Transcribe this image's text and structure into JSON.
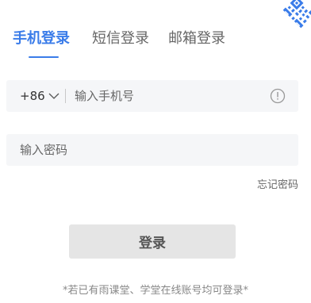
{
  "colors": {
    "accent": "#3a7ce9",
    "qr_blue": "#3a7ce9",
    "field_bg": "#f5f6f8",
    "button_bg": "#e5e5e5"
  },
  "qr_toggle": {
    "icon": "qr-code-icon"
  },
  "tabs": [
    {
      "label": "手机登录",
      "active": true
    },
    {
      "label": "短信登录",
      "active": false
    },
    {
      "label": "邮箱登录",
      "active": false
    }
  ],
  "phone": {
    "country_code": "+86",
    "placeholder": "输入手机号",
    "value": "",
    "info_icon": "info-circle-icon"
  },
  "password": {
    "placeholder": "输入密码",
    "value": ""
  },
  "forgot_label": "忘记密码",
  "login_label": "登录",
  "footer_note": "*若已有雨课堂、学堂在线账号均可登录*"
}
